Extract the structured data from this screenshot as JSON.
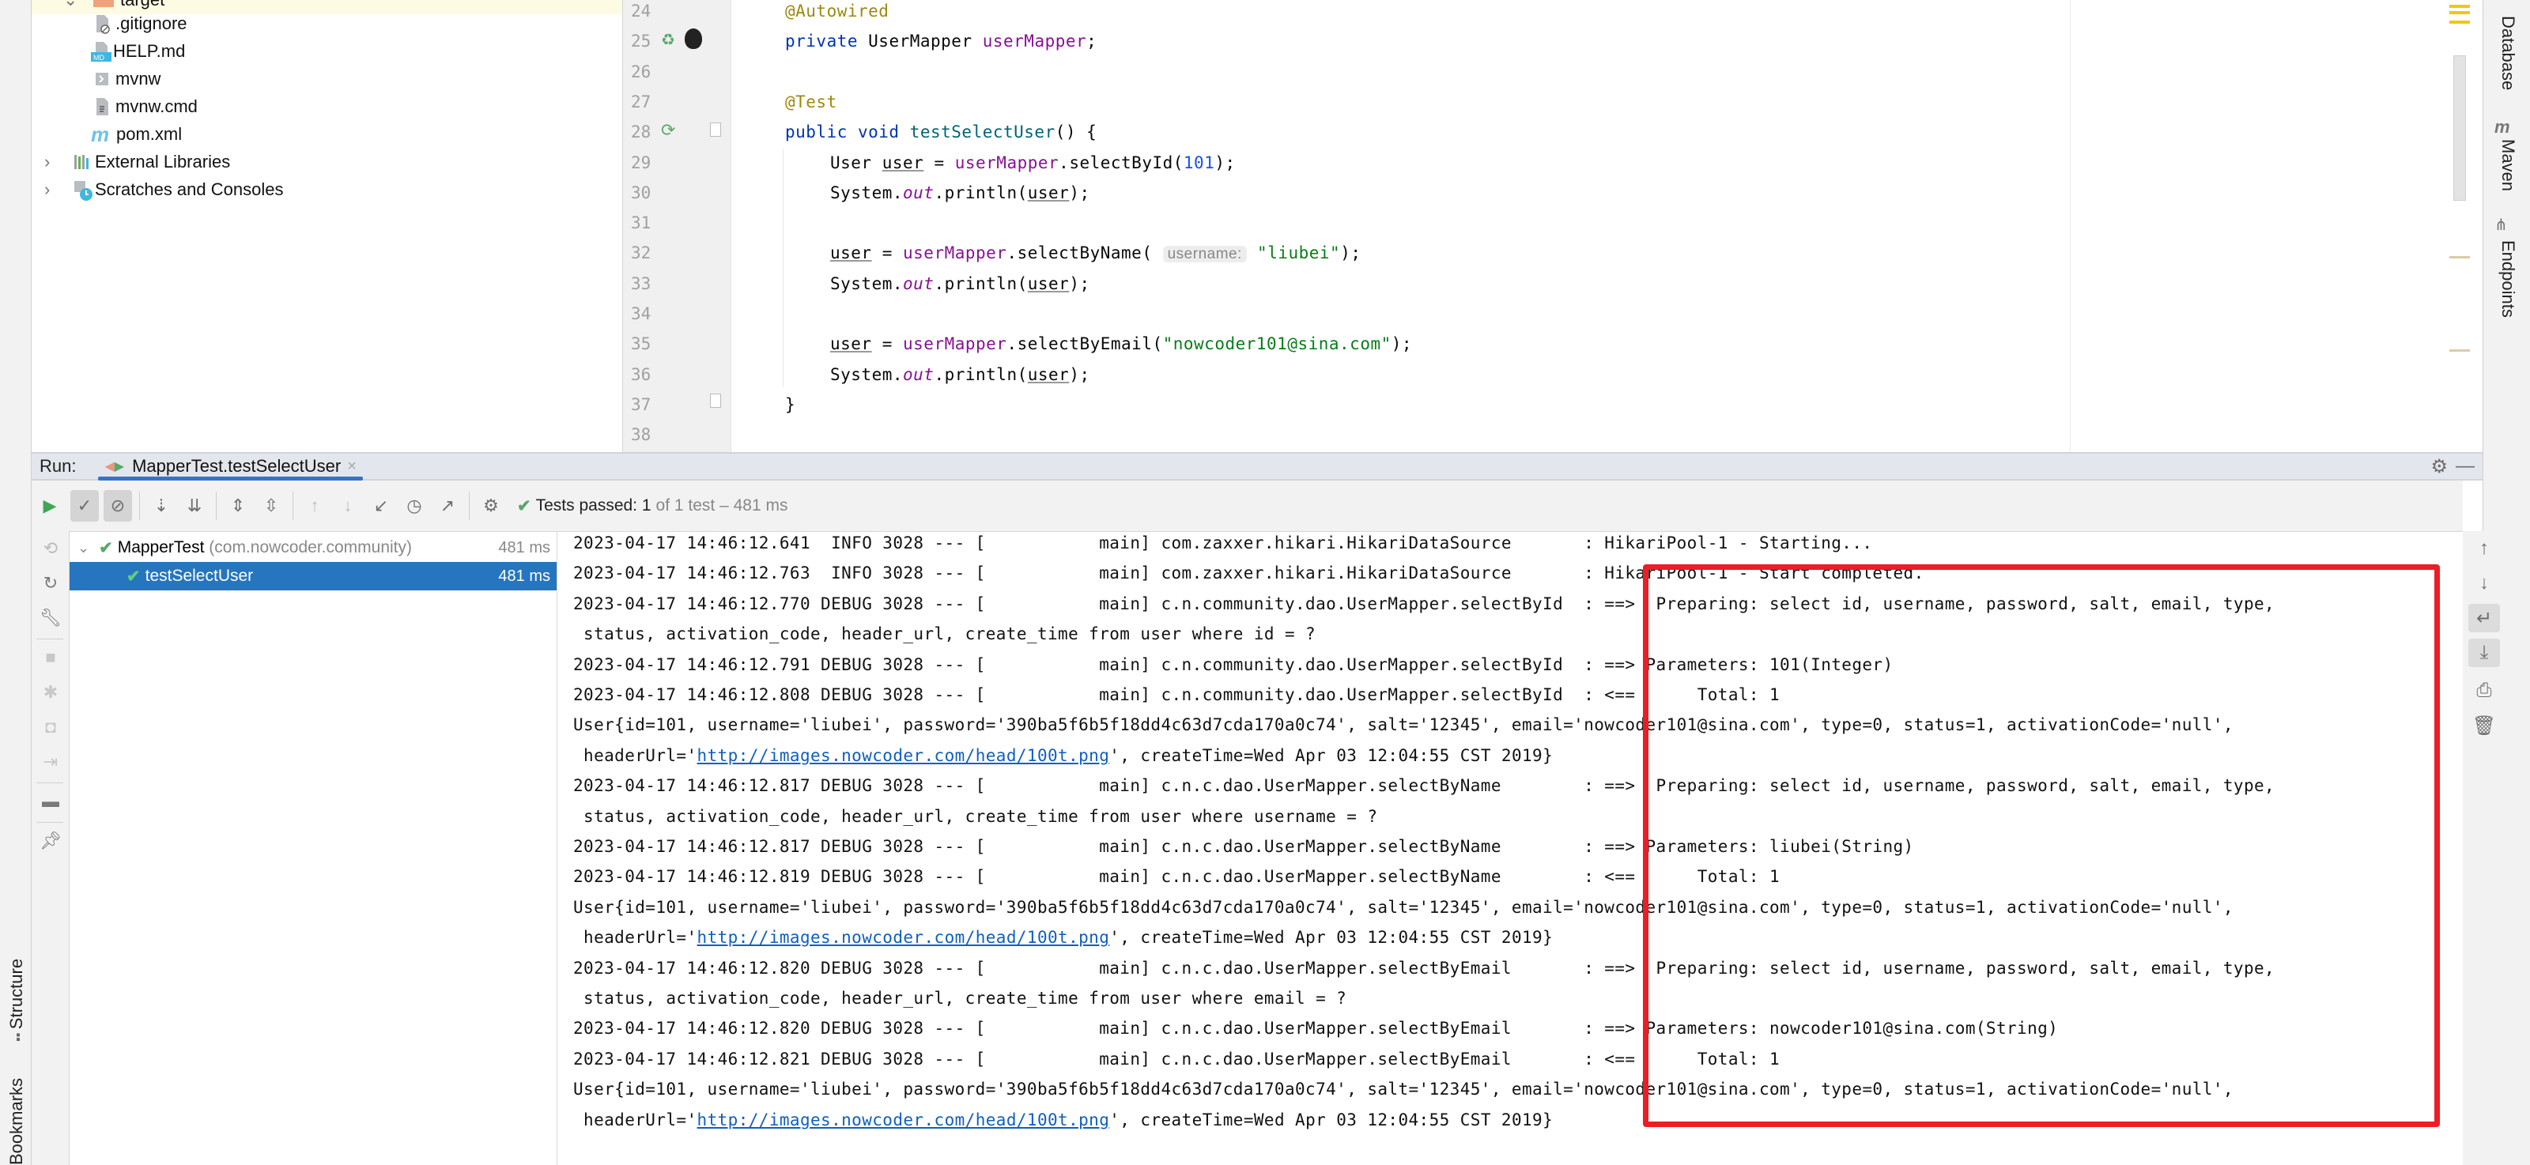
{
  "project_tree": {
    "items": [
      {
        "label": "target",
        "icon": "folder-icon",
        "depth": 1,
        "highlight": true
      },
      {
        "label": ".gitignore",
        "icon": "gitignore-file-icon",
        "depth": 2
      },
      {
        "label": "HELP.md",
        "icon": "markdown-file-icon",
        "depth": 2
      },
      {
        "label": "mvnw",
        "icon": "shell-script-icon",
        "depth": 2
      },
      {
        "label": "mvnw.cmd",
        "icon": "text-file-icon",
        "depth": 2
      },
      {
        "label": "pom.xml",
        "icon": "maven-file-icon",
        "depth": 2
      },
      {
        "label": "External Libraries",
        "icon": "libraries-icon",
        "depth": 0
      },
      {
        "label": "Scratches and Consoles",
        "icon": "scratches-icon",
        "depth": 0
      }
    ]
  },
  "editor": {
    "lines": [
      {
        "num": "24",
        "html_parts": [
          [
            "ann",
            "@Autowired"
          ]
        ],
        "indent": 1
      },
      {
        "num": "25",
        "html_parts": [
          [
            "kw",
            "private "
          ],
          [
            "",
            "UserMapper "
          ],
          [
            "fld",
            "userMapper"
          ],
          [
            "",
            ";"
          ]
        ],
        "indent": 1
      },
      {
        "num": "26",
        "html_parts": [],
        "indent": 1
      },
      {
        "num": "27",
        "html_parts": [
          [
            "ann",
            "@Test"
          ]
        ],
        "indent": 1
      },
      {
        "num": "28",
        "html_parts": [
          [
            "kw",
            "public void "
          ],
          [
            "fn",
            "testSelectUser"
          ],
          [
            "",
            "() {"
          ]
        ],
        "indent": 1
      },
      {
        "num": "29",
        "html_parts": [
          [
            "",
            "User "
          ],
          [
            "ul",
            "user"
          ],
          [
            "",
            " = "
          ],
          [
            "fld",
            "userMapper"
          ],
          [
            "",
            ".selectById("
          ],
          [
            "num",
            "101"
          ],
          [
            "",
            ");"
          ]
        ],
        "indent": 2
      },
      {
        "num": "30",
        "html_parts": [
          [
            "",
            "System."
          ],
          [
            "it",
            "out"
          ],
          [
            "",
            ".println("
          ],
          [
            "ul",
            "user"
          ],
          [
            "",
            ");"
          ]
        ],
        "indent": 2
      },
      {
        "num": "31",
        "html_parts": [],
        "indent": 2
      },
      {
        "num": "32",
        "html_parts": [
          [
            "ul",
            "user"
          ],
          [
            "",
            " = "
          ],
          [
            "fld",
            "userMapper"
          ],
          [
            "",
            ".selectByName( "
          ],
          [
            "hint",
            "username:"
          ],
          [
            "",
            " "
          ],
          [
            "str",
            "\"liubei\""
          ],
          [
            "",
            ");"
          ]
        ],
        "indent": 2
      },
      {
        "num": "33",
        "html_parts": [
          [
            "",
            "System."
          ],
          [
            "it",
            "out"
          ],
          [
            "",
            ".println("
          ],
          [
            "ul",
            "user"
          ],
          [
            "",
            ");"
          ]
        ],
        "indent": 2
      },
      {
        "num": "34",
        "html_parts": [],
        "indent": 2
      },
      {
        "num": "35",
        "html_parts": [
          [
            "ul",
            "user"
          ],
          [
            "",
            " = "
          ],
          [
            "fld",
            "userMapper"
          ],
          [
            "",
            ".selectByEmail("
          ],
          [
            "str",
            "\"nowcoder101@sina.com\""
          ],
          [
            "",
            ");"
          ]
        ],
        "indent": 2
      },
      {
        "num": "36",
        "html_parts": [
          [
            "",
            "System."
          ],
          [
            "it",
            "out"
          ],
          [
            "",
            ".println("
          ],
          [
            "ul",
            "user"
          ],
          [
            "",
            ");"
          ]
        ],
        "indent": 2
      },
      {
        "num": "37",
        "html_parts": [
          [
            "",
            "}"
          ]
        ],
        "indent": 1
      },
      {
        "num": "38",
        "html_parts": [],
        "indent": 1
      }
    ]
  },
  "right_strip": {
    "tabs": [
      "Database",
      "Maven",
      "Endpoints"
    ]
  },
  "left_strip": {
    "tabs": [
      "Structure",
      "Bookmarks"
    ]
  },
  "run_panel": {
    "label": "Run:",
    "tab_title": "MapperTest.testSelectUser",
    "close_glyph": "×",
    "status": {
      "prefix": "Tests passed:",
      "passed": "1",
      "detail": "of 1 test – 481 ms"
    },
    "test_tree": [
      {
        "name": "MapperTest",
        "package": "(com.nowcoder.community)",
        "time": "481 ms",
        "selected": false
      },
      {
        "name": "testSelectUser",
        "package": "",
        "time": "481 ms",
        "selected": true
      }
    ],
    "console_lines": [
      "2023-04-17 14:46:12.641  INFO 3028 --- [           main] com.zaxxer.hikari.HikariDataSource       : HikariPool-1 - Starting...",
      "2023-04-17 14:46:12.763  INFO 3028 --- [           main] com.zaxxer.hikari.HikariDataSource       : HikariPool-1 - Start completed.",
      "2023-04-17 14:46:12.770 DEBUG 3028 --- [           main] c.n.community.dao.UserMapper.selectById  : ==>  Preparing: select id, username, password, salt, email, type,",
      " status, activation_code, header_url, create_time from user where id = ?",
      "2023-04-17 14:46:12.791 DEBUG 3028 --- [           main] c.n.community.dao.UserMapper.selectById  : ==> Parameters: 101(Integer)",
      "2023-04-17 14:46:12.808 DEBUG 3028 --- [           main] c.n.community.dao.UserMapper.selectById  : <==      Total: 1",
      "User{id=101, username='liubei', password='390ba5f6b5f18dd4c63d7cda170a0c74', salt='12345', email='nowcoder101@sina.com', type=0, status=1, activationCode='null',",
      {
        "prefix": " headerUrl='",
        "link": "http://images.nowcoder.com/head/100t.png",
        "suffix": "', createTime=Wed Apr 03 12:04:55 CST 2019}"
      },
      "2023-04-17 14:46:12.817 DEBUG 3028 --- [           main] c.n.c.dao.UserMapper.selectByName        : ==>  Preparing: select id, username, password, salt, email, type,",
      " status, activation_code, header_url, create_time from user where username = ?",
      "2023-04-17 14:46:12.817 DEBUG 3028 --- [           main] c.n.c.dao.UserMapper.selectByName        : ==> Parameters: liubei(String)",
      "2023-04-17 14:46:12.819 DEBUG 3028 --- [           main] c.n.c.dao.UserMapper.selectByName        : <==      Total: 1",
      "User{id=101, username='liubei', password='390ba5f6b5f18dd4c63d7cda170a0c74', salt='12345', email='nowcoder101@sina.com', type=0, status=1, activationCode='null',",
      {
        "prefix": " headerUrl='",
        "link": "http://images.nowcoder.com/head/100t.png",
        "suffix": "', createTime=Wed Apr 03 12:04:55 CST 2019}"
      },
      "2023-04-17 14:46:12.820 DEBUG 3028 --- [           main] c.n.c.dao.UserMapper.selectByEmail       : ==>  Preparing: select id, username, password, salt, email, type,",
      " status, activation_code, header_url, create_time from user where email = ?",
      "2023-04-17 14:46:12.820 DEBUG 3028 --- [           main] c.n.c.dao.UserMapper.selectByEmail       : ==> Parameters: nowcoder101@sina.com(String)",
      "2023-04-17 14:46:12.821 DEBUG 3028 --- [           main] c.n.c.dao.UserMapper.selectByEmail       : <==      Total: 1",
      "User{id=101, username='liubei', password='390ba5f6b5f18dd4c63d7cda170a0c74', salt='12345', email='nowcoder101@sina.com', type=0, status=1, activationCode='null',",
      {
        "prefix": " headerUrl='",
        "link": "http://images.nowcoder.com/head/100t.png",
        "suffix": "', createTime=Wed Apr 03 12:04:55 CST 2019}"
      }
    ]
  },
  "colors": {
    "annotation_box": "#ee1c25",
    "selection": "#2675bf",
    "pass_green": "#59a869",
    "link": "#0f5fbf"
  }
}
